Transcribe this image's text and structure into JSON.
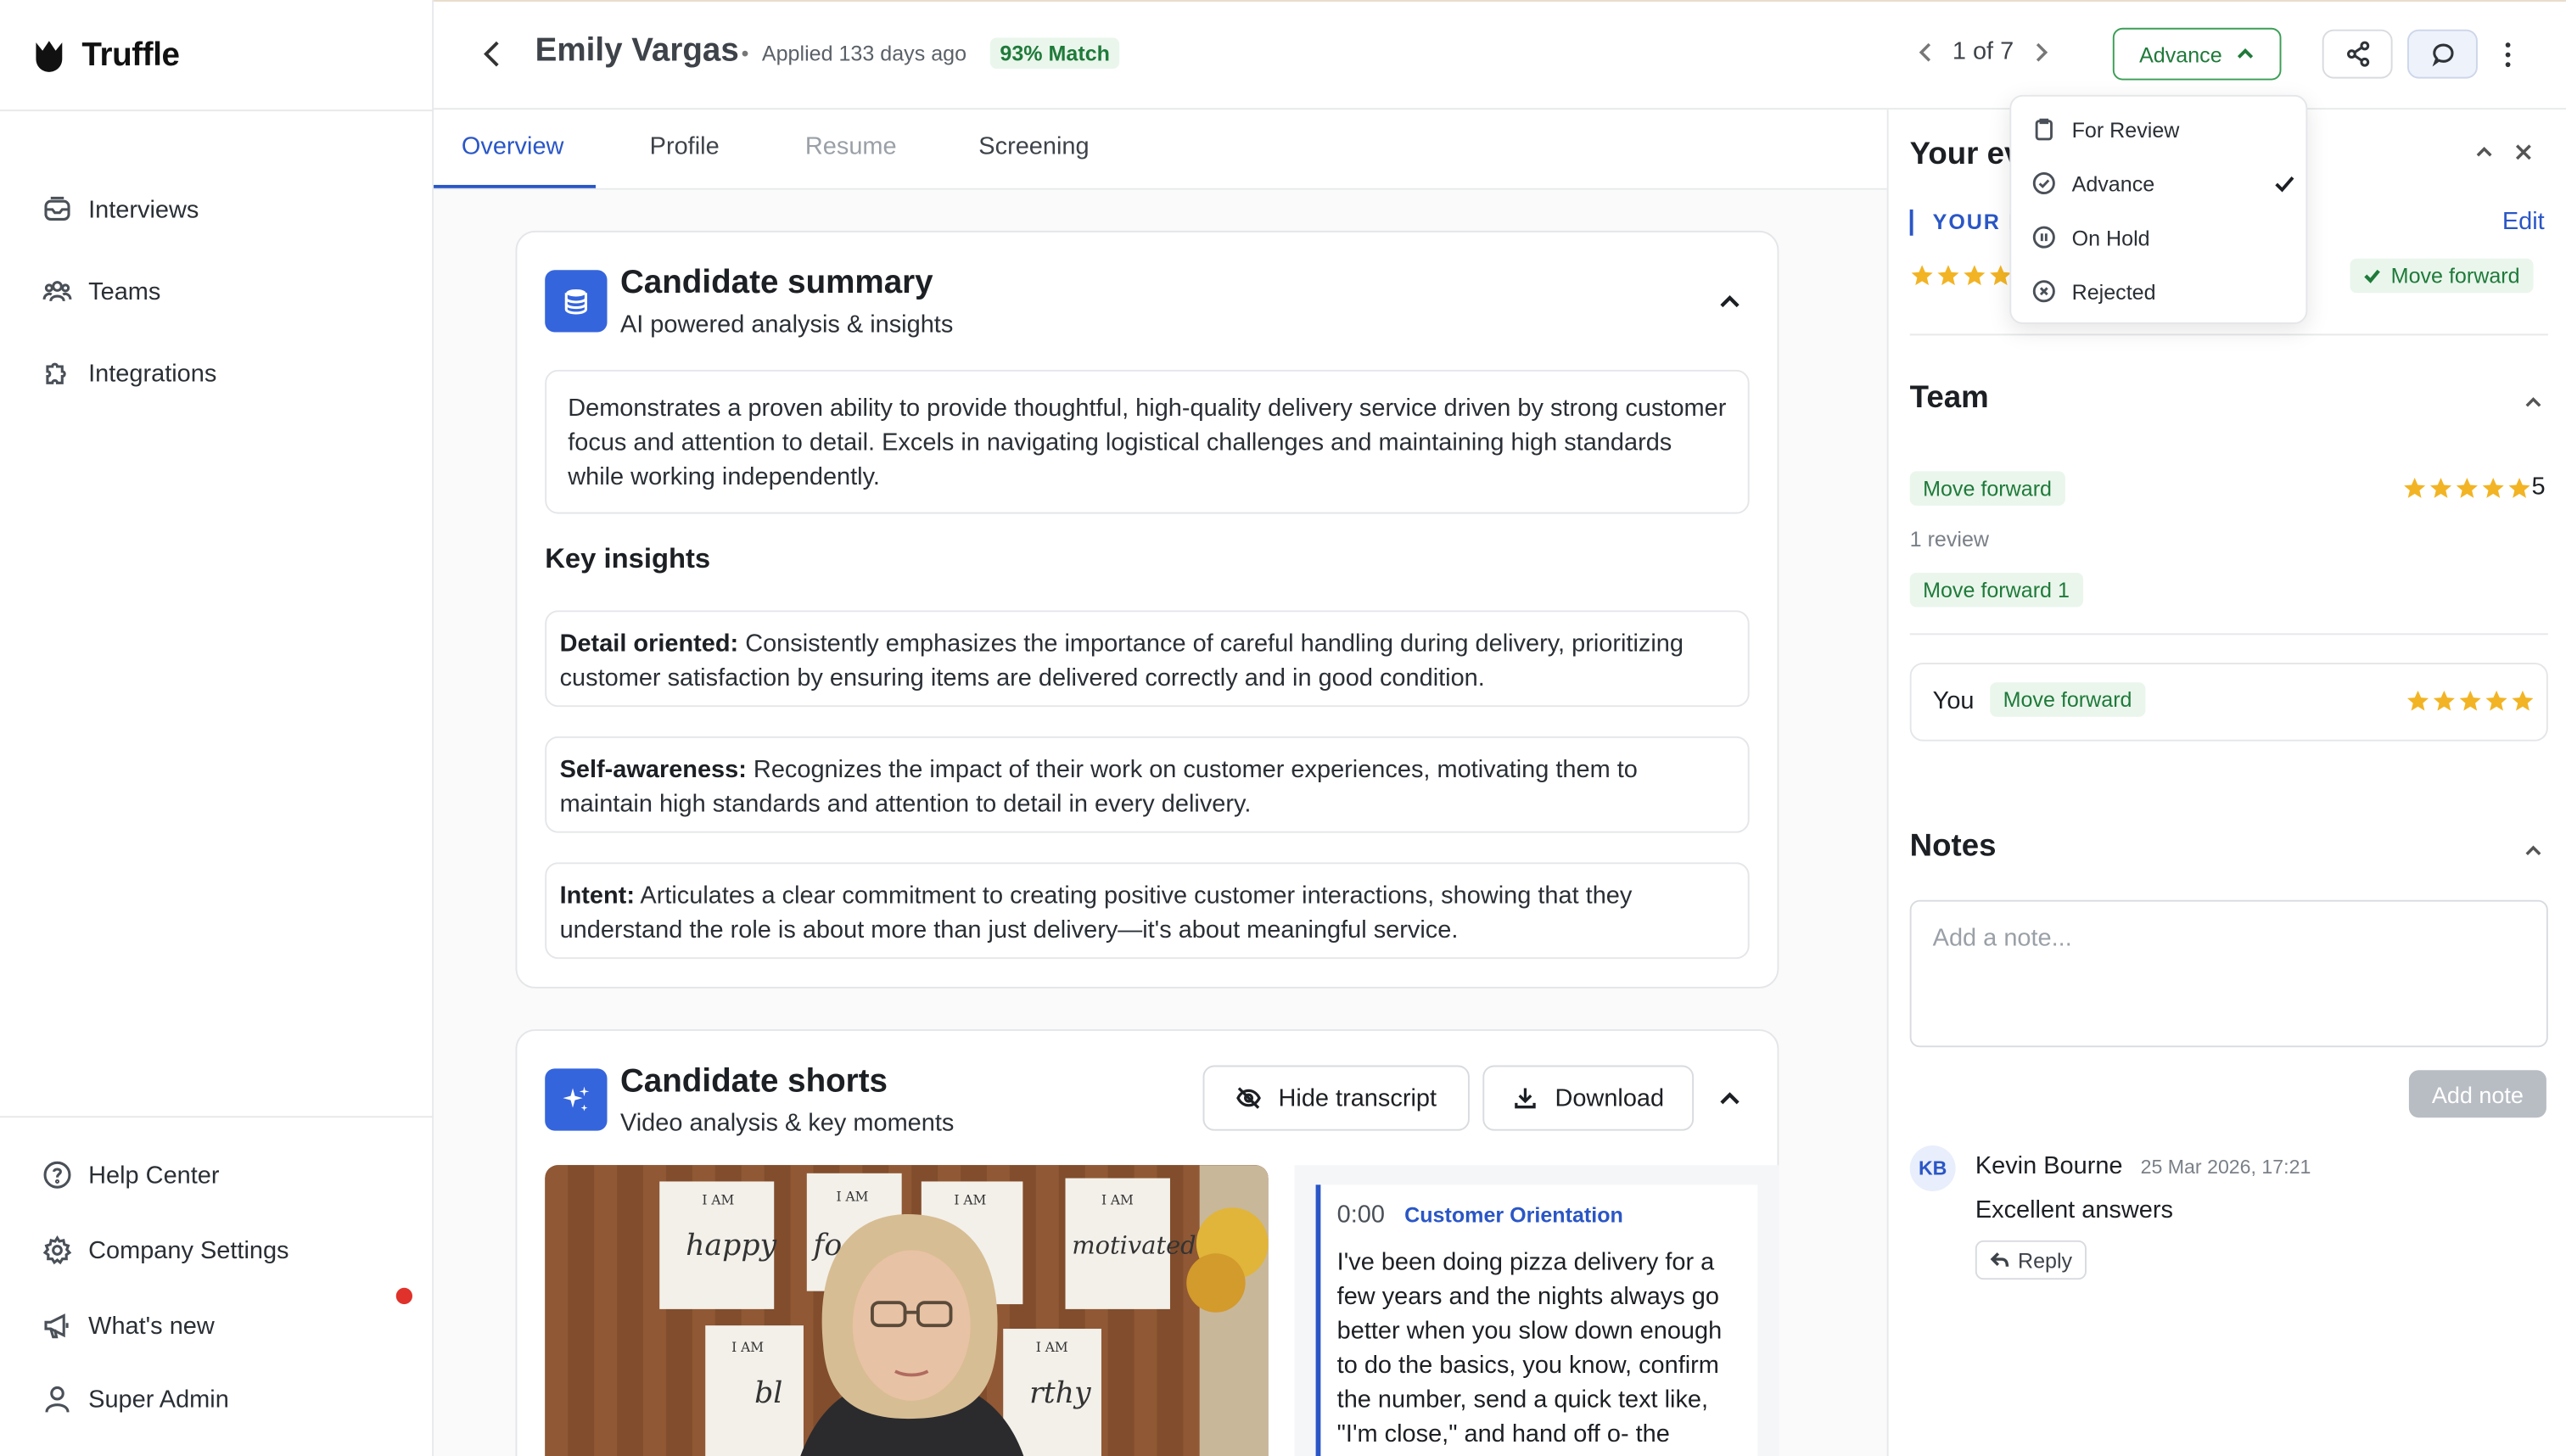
{
  "app": {
    "name": "Truffle"
  },
  "sidebar": {
    "items": [
      {
        "label": "Interviews",
        "icon": "inbox-icon"
      },
      {
        "label": "Teams",
        "icon": "users-icon"
      },
      {
        "label": "Integrations",
        "icon": "puzzle-icon"
      }
    ],
    "bottom_items": [
      {
        "label": "Help Center",
        "icon": "help-circle-icon"
      },
      {
        "label": "Company Settings",
        "icon": "gear-icon"
      },
      {
        "label": "What's new",
        "icon": "megaphone-icon"
      },
      {
        "label": "Super Admin",
        "icon": "user-icon"
      }
    ]
  },
  "header": {
    "candidate_name": "Emily Vargas",
    "applied": "Applied 133 days ago",
    "match": "93% Match",
    "pager": "1 of 7",
    "status_button": "Advance"
  },
  "tabs": [
    {
      "label": "Overview",
      "state": "active"
    },
    {
      "label": "Profile",
      "state": "normal"
    },
    {
      "label": "Resume",
      "state": "muted"
    },
    {
      "label": "Screening",
      "state": "normal"
    }
  ],
  "summary_card": {
    "title": "Candidate summary",
    "subtitle": "AI powered analysis & insights",
    "summary": "Demonstrates a proven ability to provide thoughtful, high-quality delivery service driven by strong customer focus and attention to detail. Excels in navigating logistical challenges and maintaining high standards while working independently.",
    "key_insights_title": "Key insights",
    "insights": [
      {
        "label": "Detail oriented:",
        "text": " Consistently emphasizes the importance of careful handling during delivery, prioritizing customer satisfaction by ensuring items are delivered correctly and in good condition."
      },
      {
        "label": "Self-awareness:",
        "text": " Recognizes the impact of their work on customer experiences, motivating them to maintain high standards and attention to detail in every delivery."
      },
      {
        "label": "Intent:",
        "text": " Articulates a clear commitment to creating positive customer interactions, showing that they understand the role is about more than just delivery—it's about meaningful service."
      }
    ]
  },
  "shorts_card": {
    "title": "Candidate shorts",
    "subtitle": "Video analysis & key moments",
    "hide_transcript": "Hide transcript",
    "download": "Download",
    "transcript": {
      "time": "0:00",
      "tag": "Customer Orientation",
      "text": "I've been doing pizza delivery for a few years and the nights always go better when you slow down enough to do the basics, you know, confirm the number, send a quick text like, \"I'm close,\" and hand off o- the"
    },
    "video_posters": [
      "I AM",
      "happy",
      "I AM",
      "foc",
      "I AM",
      "I AM",
      "motivated",
      "I AM",
      "bl",
      "I AM",
      "rthy"
    ]
  },
  "status_dropdown": {
    "options": [
      {
        "label": "For Review",
        "icon": "clipboard-icon"
      },
      {
        "label": "Advance",
        "icon": "check-circle-icon",
        "selected": true
      },
      {
        "label": "On Hold",
        "icon": "pause-circle-icon"
      },
      {
        "label": "Rejected",
        "icon": "x-circle-icon"
      }
    ]
  },
  "right_panel": {
    "title": "Your ev",
    "your_eval_label": "YOUR E",
    "edit": "Edit",
    "your_rating": 5,
    "your_decision": "Move forward",
    "team": {
      "title": "Team",
      "decision": "Move forward",
      "rating": 5,
      "rating_label": "5",
      "reviews": "1 review",
      "summary_badge": "Move forward 1",
      "you_label": "You",
      "you_decision": "Move forward",
      "you_rating": 5
    },
    "notes": {
      "title": "Notes",
      "placeholder": "Add a note...",
      "add_button": "Add note",
      "comments": [
        {
          "initials": "KB",
          "author": "Kevin Bourne",
          "time": "25 Mar 2026, 17:21",
          "text": "Excellent answers",
          "reply": "Reply"
        }
      ]
    }
  },
  "colors": {
    "accent": "#2a56c6",
    "success": "#1f7a3a",
    "success_bg": "#eaf6ec",
    "star": "#f2b424",
    "alert": "#e0312b"
  }
}
